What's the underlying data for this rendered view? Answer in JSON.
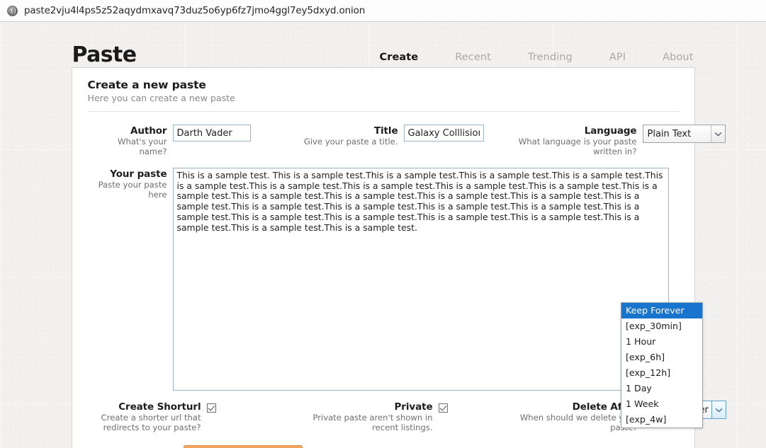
{
  "browser": {
    "icon": "onion-globe-icon",
    "url": "paste2vju4l4ps5z52aqydmxavq73duz5o6yp6fz7jmo4ggl7ey5dxyd.onion"
  },
  "site": {
    "brand": "Paste",
    "nav": [
      {
        "label": "Create",
        "active": true
      },
      {
        "label": "Recent",
        "active": false
      },
      {
        "label": "Trending",
        "active": false
      },
      {
        "label": "API",
        "active": false
      },
      {
        "label": "About",
        "active": false
      }
    ]
  },
  "form": {
    "title": "Create a new paste",
    "subtitle": "Here you can create a new paste",
    "author": {
      "label": "Author",
      "help": "What's your name?",
      "value": "Darth Vader",
      "placeholder": ""
    },
    "paste_title": {
      "label": "Title",
      "help": "Give your paste a title.",
      "value": "Galaxy Colllision",
      "placeholder": ""
    },
    "language": {
      "label": "Language",
      "help": "What language is your paste written in?",
      "value": "Plain Text"
    },
    "paste": {
      "label": "Your paste",
      "help": "Paste your paste here",
      "value": "This is a sample test. This is a sample test.This is a sample test.This is a sample test.This is a sample test.This is a sample test.This is a sample test.This is a sample test.This is a sample test.This is a sample test.This is a sample test.This is a sample test.This is a sample test.This is a sample test.This is a sample test.This is a sample test.This is a sample test.This is a sample test.This is a sample test.This is a sample test.This is a sample test.This is a sample test.This is a sample test.This is a sample test.This is a sample test.This is a sample test.This is a sample test.This is a sample test."
    },
    "shorturl": {
      "label": "Create Shorturl",
      "help": "Create a shorter url that redirects to your paste?",
      "checked": true
    },
    "private": {
      "label": "Private",
      "help": "Private paste aren't shown in recent listings.",
      "checked": true
    },
    "delete_after": {
      "label": "Delete After",
      "help": "When should we delete your paste?",
      "value": "Keep Forever"
    }
  },
  "dropdown": {
    "open": true,
    "selected": "Keep Forever",
    "options": [
      "Keep Forever",
      "[exp_30min]",
      "1 Hour",
      "[exp_6h]",
      "[exp_12h]",
      "1 Day",
      "1 Week",
      "[exp_4w]"
    ]
  },
  "colors": {
    "accent_blue": "#1874cd",
    "submit_orange": "#f09a52",
    "page_bg": "#f2f1ef",
    "panel_bg": "#ffffff",
    "input_border": "#9ab3c6"
  }
}
